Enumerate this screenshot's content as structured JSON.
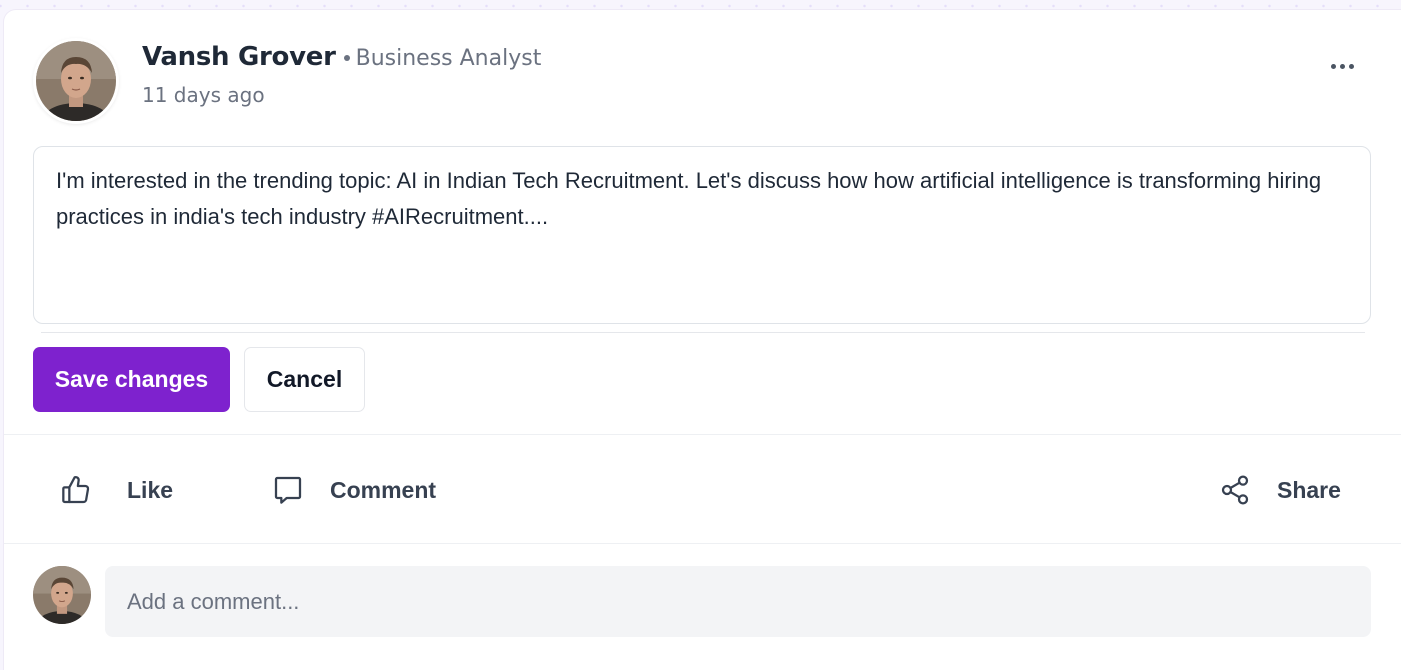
{
  "post": {
    "author": {
      "name": "Vansh Grover",
      "role": "Business Analyst"
    },
    "timestamp": "11 days ago",
    "more_icon": "more-horizontal-icon"
  },
  "editor": {
    "content": "I'm interested in the trending topic: AI in Indian Tech Recruitment. Let's discuss how how artificial intelligence is transforming hiring practices in india's tech industry #AIRecruitment....",
    "save_label": "Save changes",
    "cancel_label": "Cancel",
    "accent_color": "#7e22ce"
  },
  "actions": {
    "like": {
      "label": "Like",
      "icon": "thumbs-up-icon"
    },
    "comment": {
      "label": "Comment",
      "icon": "chat-bubble-icon"
    },
    "share": {
      "label": "Share",
      "icon": "share-icon"
    }
  },
  "comment_box": {
    "placeholder": "Add a comment..."
  }
}
